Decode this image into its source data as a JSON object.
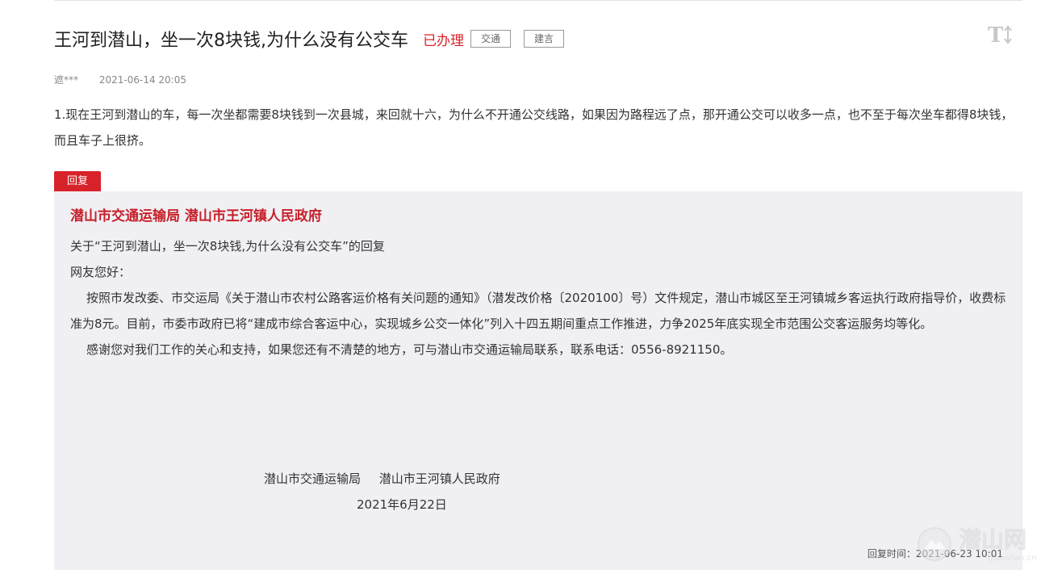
{
  "post": {
    "title": "王河到潜山，坐一次8块钱,为什么没有公交车",
    "status": "已办理",
    "tags": [
      "交通",
      "建言"
    ],
    "author": "遮***",
    "date": "2021-06-14 20:05",
    "content": "1.现在王河到潜山的车，每一次坐都需要8块钱到一次县城，来回就十六，为什么不开通公交线路，如果因为路程远了点，那开通公交可以收多一点，也不至于每次坐车都得8块钱，而且车子上很挤。"
  },
  "reply": {
    "badge": "回复",
    "org_header": "潜山市交通运输局 潜山市王河镇人民政府",
    "subject": "关于“王河到潜山，坐一次8块钱,为什么没有公交车”的回复",
    "greeting": "网友您好：",
    "paragraph1": "按照市发改委、市交运局《关于潜山市农村公路客运价格有关问题的通知》（潜发改价格〔2020100〕号）文件规定，潜山市城区至王河镇城乡客运执行政府指导价，收费标准为8元。目前，市委市政府已将“建成市综合客运中心，实现城乡公交一体化”列入十四五期间重点工作推进，力争2025年底实现全市范围公交客运服务均等化。",
    "paragraph2": "感谢您对我们工作的关心和支持，如果您还有不清楚的地方，可与潜山市交通运输局联系，联系电话：0556-8921150。",
    "signature_org1": "潜山市交通运输局",
    "signature_org2": "潜山市王河镇人民政府",
    "signature_date": "2021年6月22日",
    "reply_time": "回复时间：2021-06-23 10:01"
  },
  "watermark": {
    "text": "潜山网",
    "url_text": "qianshan.cn"
  },
  "colors": {
    "accent_red": "#d8222a",
    "panel_bg": "#f0f0f4"
  },
  "icons": {
    "font_size_toggle": "text-size-icon"
  }
}
